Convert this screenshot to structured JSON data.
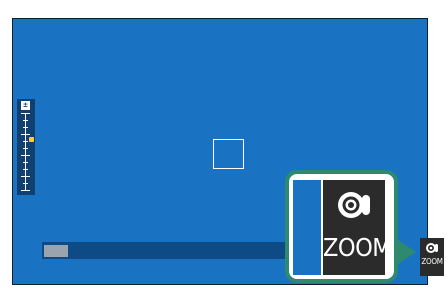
{
  "viewfinder": {
    "ev_scale": {
      "icon_label": "±",
      "indicator_color": "#ffd21a"
    },
    "zoom_button": {
      "label": "ZOOM",
      "icon": "lens-icon"
    },
    "callout": {
      "label": "ZOOM",
      "icon": "lens-icon",
      "accent": "#2d8a6f"
    },
    "colors": {
      "background": "#1a72c3",
      "dark": "#2b2b2b"
    }
  }
}
